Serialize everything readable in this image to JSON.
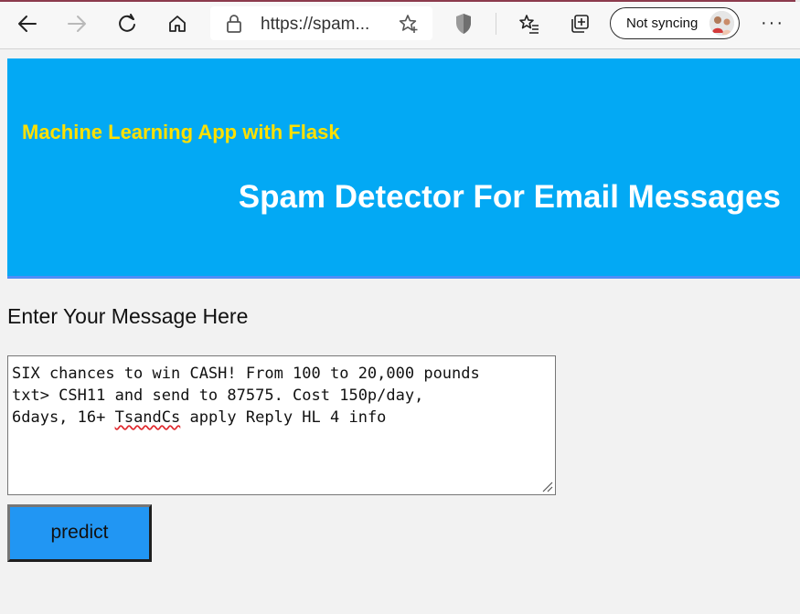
{
  "browser": {
    "url_display": "https://spam...",
    "sync_label": "Not syncing",
    "more_label": "···"
  },
  "page": {
    "header_subtitle": "Machine Learning App with Flask",
    "header_title": "Spam Detector For Email Messages",
    "prompt_label": "Enter Your Message Here",
    "message_text": {
      "line1": "SIX chances to win CASH! From 100 to 20,000 pounds",
      "line2": "txt> CSH11 and send to 87575. Cost 150p/day,",
      "line3_before": "6days, 16+ ",
      "line3_misspelled": "TsandCs",
      "line3_after": " apply Reply HL 4 info"
    },
    "predict_button": "predict"
  },
  "colors": {
    "banner_bg": "#03a9f4",
    "subtitle_color": "#ffe000",
    "title_color": "#ffffff",
    "button_bg": "#2196f3",
    "page_bg": "#f2f2f2"
  }
}
